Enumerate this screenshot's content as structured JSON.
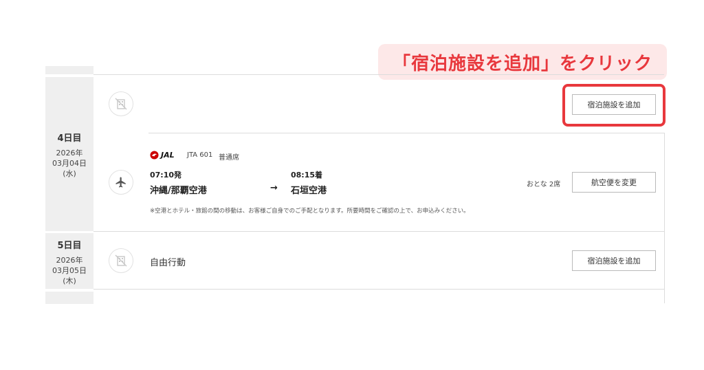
{
  "callout": {
    "text": "「宿泊施設を追加」をクリック"
  },
  "days": [
    {
      "title": "4日目",
      "year": "2026年",
      "date": "03月04日",
      "dow": "(水)",
      "hotel_button": "宿泊施設を追加",
      "flight": {
        "airline": "JAL",
        "flight_number": "JTA 601",
        "seat_class": "普通席",
        "depart_time": "07:10発",
        "depart_airport": "沖縄/那覇空港",
        "arrow": "→",
        "arrive_time": "08:15着",
        "arrive_airport": "石垣空港",
        "passengers": "おとな 2席",
        "change_button": "航空便を変更",
        "note": "※空港とホテル・旅館の間の移動は、お客様ご自身でのご手配となります。所要時間をご確認の上で、お申込みください。"
      }
    },
    {
      "title": "5日目",
      "year": "2026年",
      "date": "03月05日",
      "dow": "(木)",
      "activity": "自由行動",
      "hotel_button": "宿泊施設を追加"
    }
  ],
  "colors": {
    "accent": "#e8383d",
    "callout_bg": "#fde8e8",
    "jal_red": "#cc0000"
  },
  "icons": {
    "hotel": "building-slash-icon",
    "flight": "airplane-icon"
  }
}
